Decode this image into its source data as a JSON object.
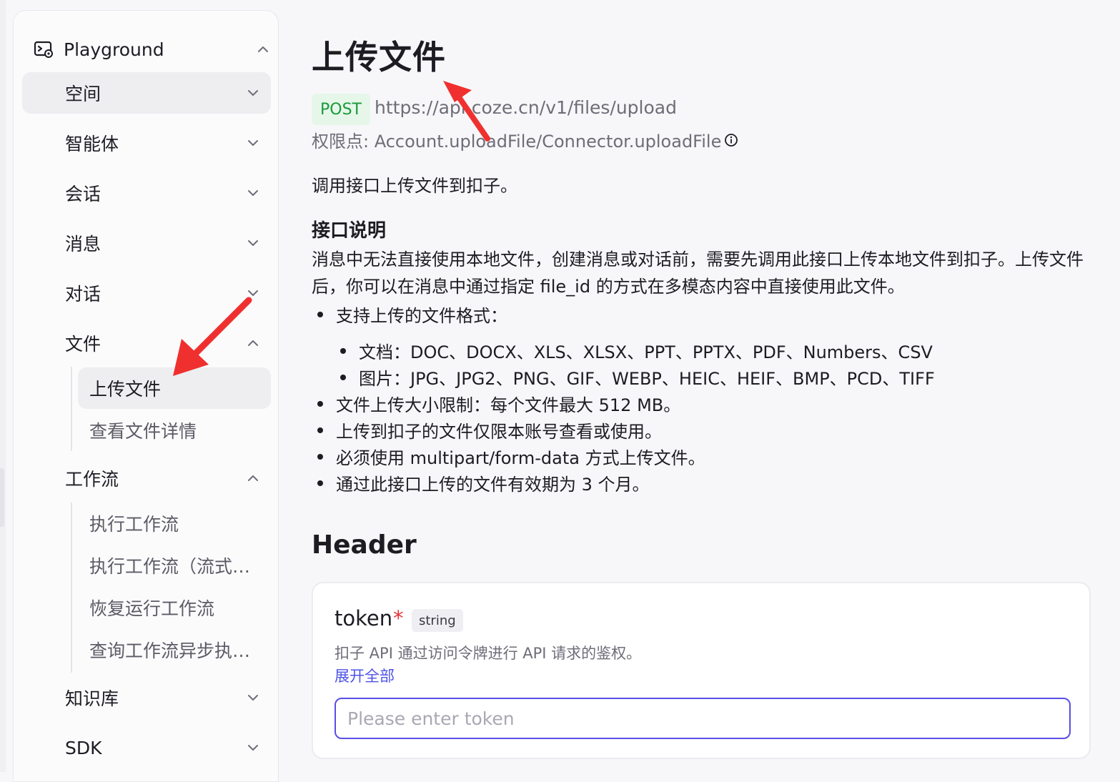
{
  "sidebar": {
    "top_label": "Playground",
    "items": [
      {
        "label": "空间"
      },
      {
        "label": "智能体"
      },
      {
        "label": "会话"
      },
      {
        "label": "消息"
      },
      {
        "label": "对话"
      },
      {
        "label": "文件"
      },
      {
        "label": "工作流"
      },
      {
        "label": "知识库"
      },
      {
        "label": "SDK"
      }
    ],
    "file_subitems": [
      {
        "label": "上传文件"
      },
      {
        "label": "查看文件详情"
      }
    ],
    "workflow_subitems": [
      {
        "label": "执行工作流"
      },
      {
        "label": "执行工作流（流式…"
      },
      {
        "label": "恢复运行工作流"
      },
      {
        "label": "查询工作流异步执…"
      }
    ]
  },
  "main": {
    "title": "上传文件",
    "method": "POST",
    "endpoint": "https://api.coze.cn/v1/files/upload",
    "permission": "权限点: Account.uploadFile/Connector.uploadFile",
    "intro": "调用接口上传文件到扣子。",
    "section_heading": "接口说明",
    "description": "消息中无法直接使用本地文件，创建消息或对话前，需要先调用此接口上传本地文件到扣子。上传文件后，你可以在消息中通过指定 file_id 的方式在多模态内容中直接使用此文件。",
    "bullets": [
      "支持上传的文件格式：",
      "文档：DOC、DOCX、XLS、XLSX、PPT、PPTX、PDF、Numbers、CSV",
      "图片：JPG、JPG2、PNG、GIF、WEBP、HEIC、HEIF、BMP、PCD、TIFF",
      "文件上传大小限制：每个文件最大 512 MB。",
      "上传到扣子的文件仅限本账号查看或使用。",
      "必须使用 multipart/form-data 方式上传文件。",
      "通过此接口上传的文件有效期为 3 个月。"
    ],
    "header_heading": "Header",
    "param": {
      "name": "token",
      "required_mark": "*",
      "type": "string",
      "description": "扣子 API 通过访问令牌进行 API 请求的鉴权。",
      "expand": "展开全部",
      "input_value": "",
      "placeholder": "Please enter token"
    }
  },
  "icons": {
    "playground": "playground-icon",
    "chevron_up": "chevron-up-icon",
    "chevron_down": "chevron-down-icon",
    "info": "info-icon",
    "annotation": "red-arrow-annotation"
  },
  "colors": {
    "accent": "#4d53e8",
    "post_green": "#1a9a3a",
    "required_red": "#e5343d",
    "annotation_red": "#f0302f"
  }
}
